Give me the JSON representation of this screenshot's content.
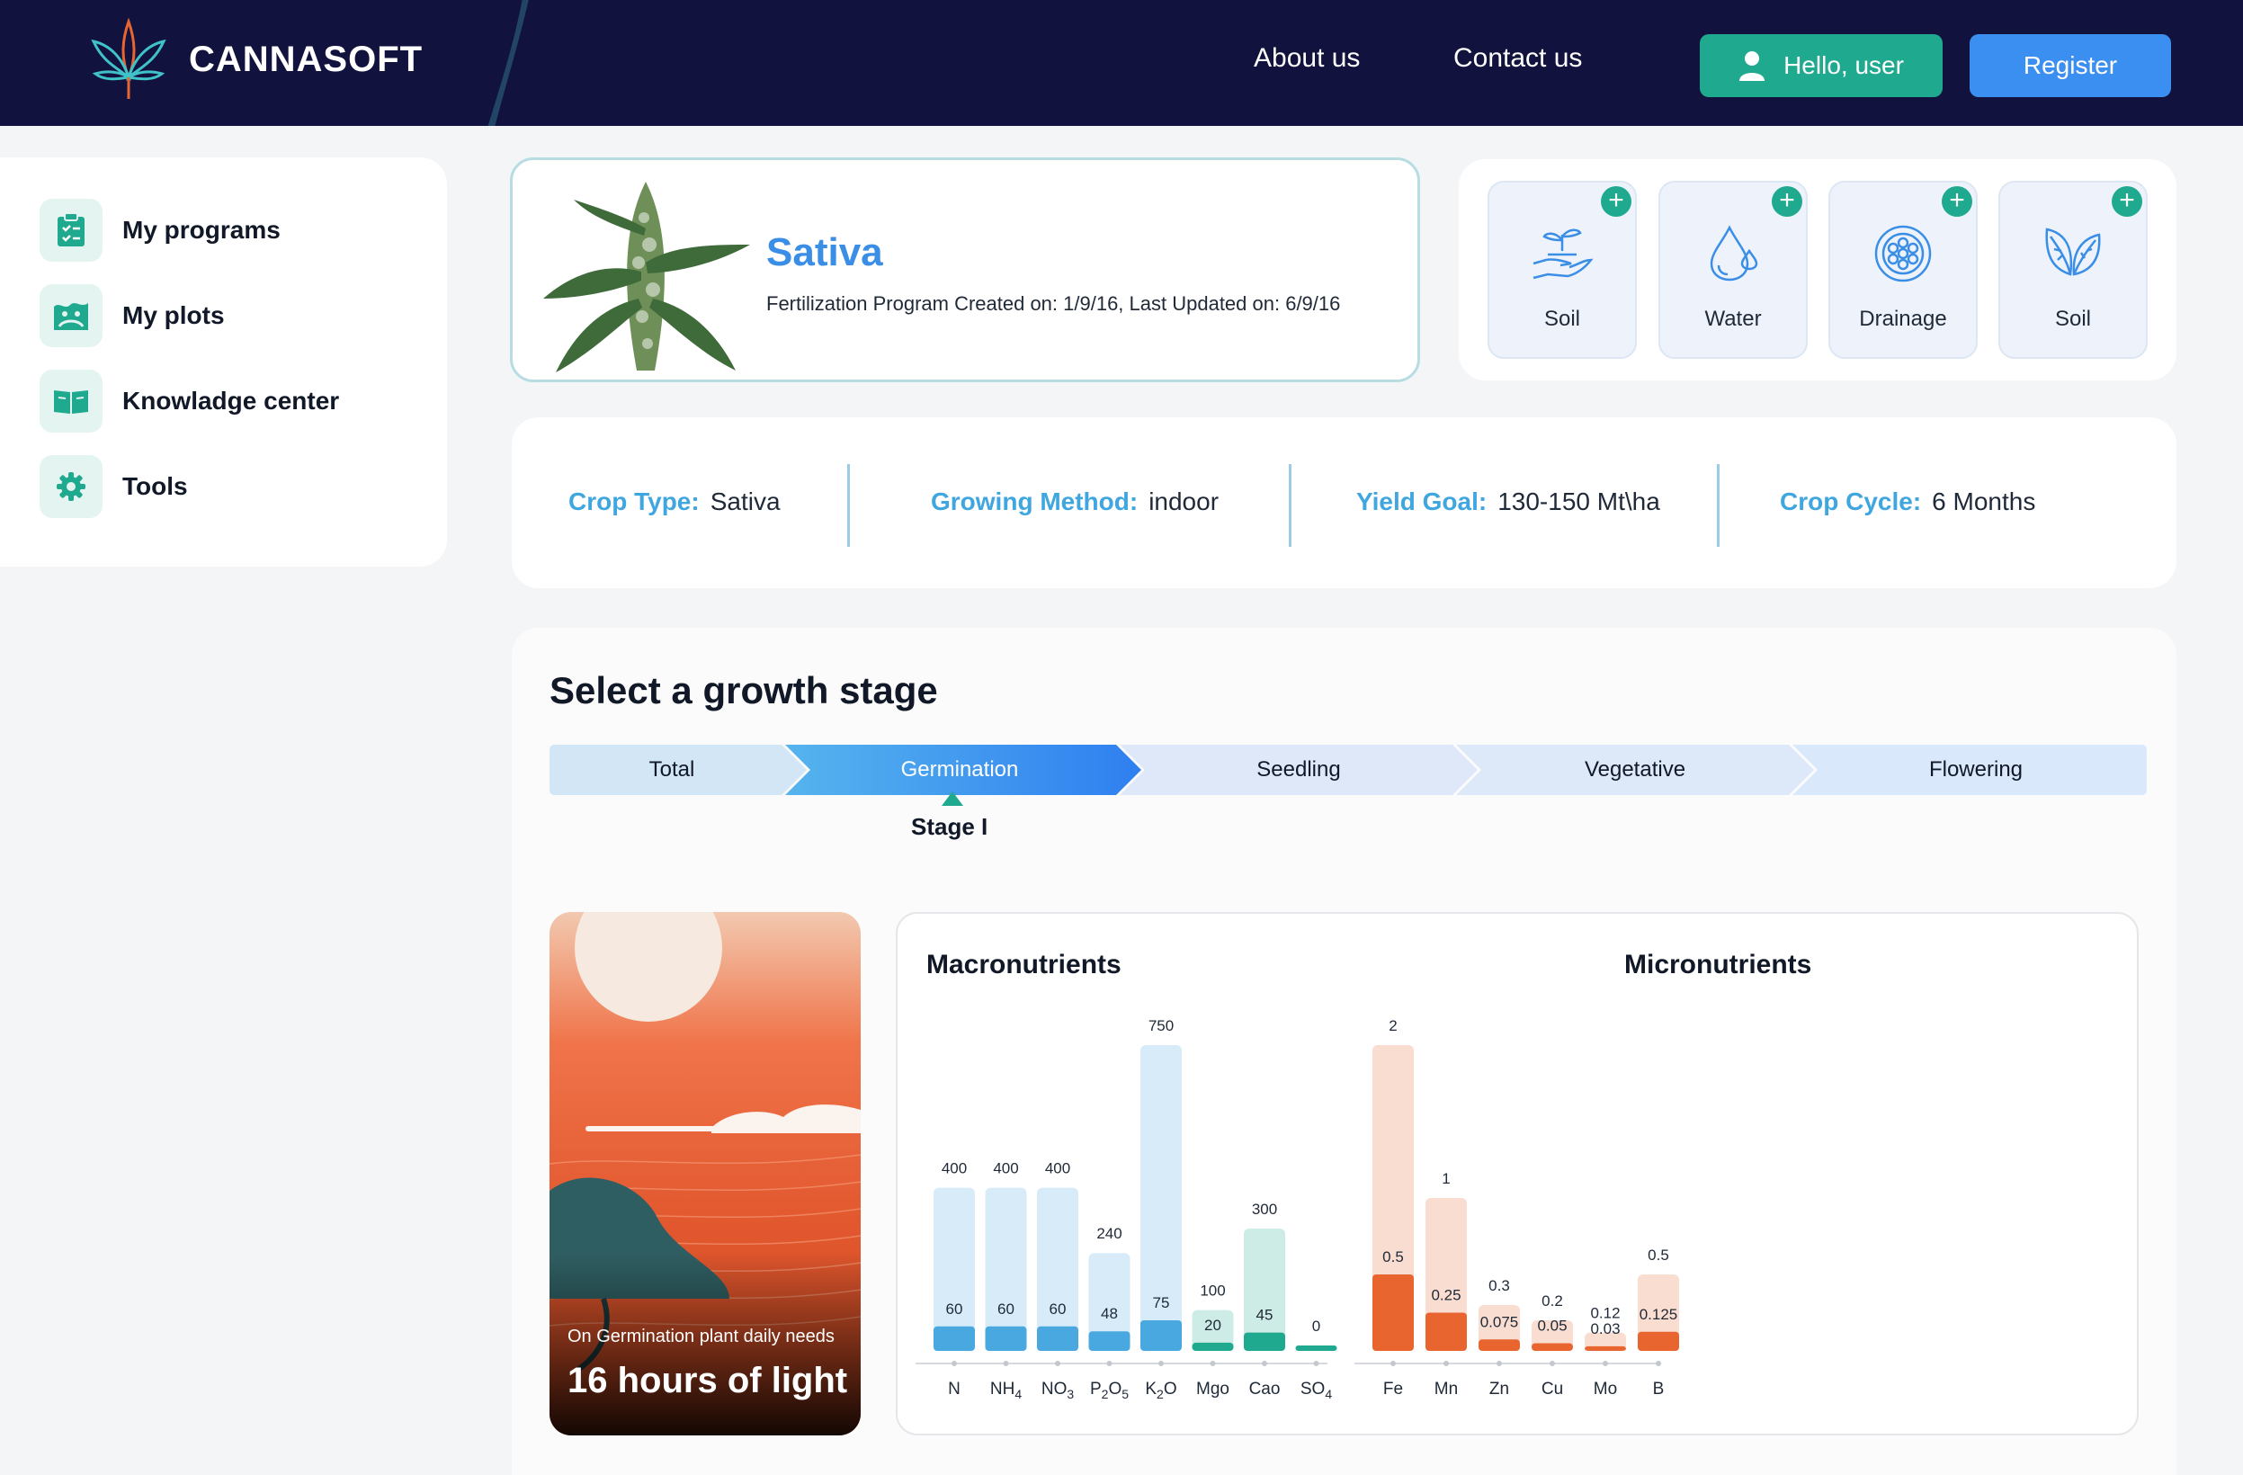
{
  "header": {
    "brand": "CANNASOFT",
    "nav": [
      "About us",
      "Contact us"
    ],
    "user_button": "Hello, user",
    "register_button": "Register"
  },
  "sidebar": {
    "items": [
      {
        "label": "My programs",
        "icon": "clipboard-check-icon"
      },
      {
        "label": "My plots",
        "icon": "plot-icon"
      },
      {
        "label": "Knowladge center",
        "icon": "book-icon"
      },
      {
        "label": "Tools",
        "icon": "gear-icon"
      }
    ]
  },
  "crop": {
    "name": "Sativa",
    "subtitle": "Fertilization Program Created on: 1/9/16, Last Updated on: 6/9/16"
  },
  "materials": [
    {
      "label": "Soil",
      "icon": "soil-hand-icon"
    },
    {
      "label": "Water",
      "icon": "water-drop-icon"
    },
    {
      "label": "Drainage",
      "icon": "drainage-icon"
    },
    {
      "label": "Soil",
      "icon": "leaves-icon"
    }
  ],
  "info": {
    "crop_type_key": "Crop Type:",
    "crop_type": "Sativa",
    "method_key": "Growing Method:",
    "method": "indoor",
    "yield_key": "Yield Goal:",
    "yield": "130-150 Mt\\ha",
    "cycle_key": "Crop Cycle:",
    "cycle": "6 Months"
  },
  "stage": {
    "title": "Select a growth stage",
    "steps": [
      "Total",
      "Germination",
      "Seedling",
      "Vegetative",
      "Flowering"
    ],
    "active_step": 1,
    "active_note": "Stage I"
  },
  "light": {
    "caption": "On Germination plant daily needs",
    "value": "16 hours of light"
  },
  "chart_data": [
    {
      "type": "bar",
      "title": "Macronutrients",
      "categories": [
        "N",
        "NH4",
        "NO3",
        "P2O5",
        "K2O",
        "Mgo",
        "Cao",
        "SO4"
      ],
      "series": [
        {
          "values": [
            400,
            400,
            400,
            240,
            750,
            100,
            300,
            0
          ]
        },
        {
          "values": [
            60,
            60,
            60,
            48,
            75,
            20,
            45,
            0
          ]
        }
      ],
      "colors": [
        "#4aa8e0",
        "#4aa8e0",
        "#4aa8e0",
        "#4aa8e0",
        "#4aa8e0",
        "#1fa98f",
        "#1fa98f",
        "#1fa98f"
      ]
    },
    {
      "type": "bar",
      "title": "Micronutrients",
      "categories": [
        "Fe",
        "Mn",
        "Zn",
        "Cu",
        "Mo",
        "B"
      ],
      "series": [
        {
          "values": [
            2,
            1,
            0.3,
            0.2,
            0.12,
            0.5
          ]
        },
        {
          "values": [
            0.5,
            0.25,
            0.075,
            0.05,
            0.03,
            0.125
          ]
        }
      ],
      "colors": [
        "#e8652f",
        "#e8652f",
        "#e8652f",
        "#e8652f",
        "#e8652f",
        "#e8652f"
      ]
    }
  ]
}
